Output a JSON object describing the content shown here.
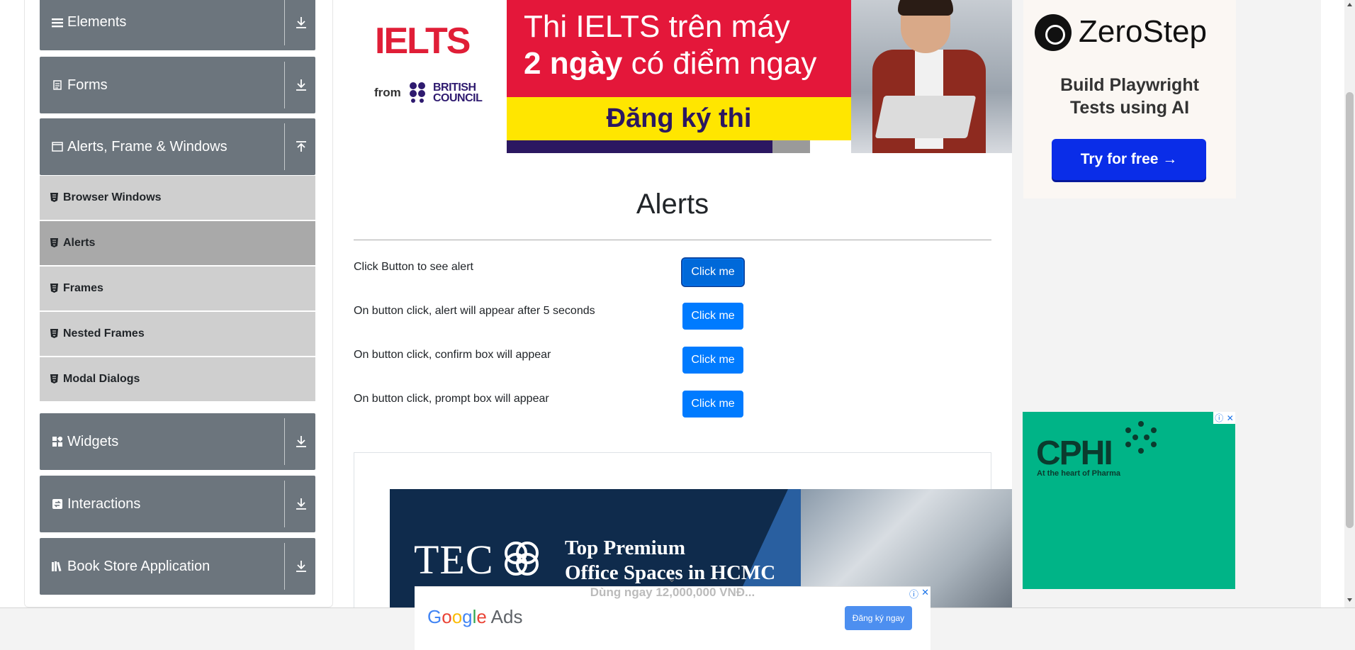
{
  "sidebar": {
    "groups": [
      {
        "label": "Elements",
        "icon": "hamburger-icon",
        "arrow": "download-icon"
      },
      {
        "label": "Forms",
        "icon": "document-icon",
        "arrow": "download-icon"
      },
      {
        "label": "Alerts, Frame & Windows",
        "icon": "window-icon",
        "arrow": "upload-icon"
      },
      {
        "label": "Widgets",
        "icon": "widgets-icon",
        "arrow": "download-icon"
      },
      {
        "label": "Interactions",
        "icon": "interactions-icon",
        "arrow": "download-icon"
      },
      {
        "label": "Book Store Application",
        "icon": "books-icon",
        "arrow": "download-icon"
      }
    ],
    "menu_items": [
      {
        "label": "Browser Windows",
        "active": false
      },
      {
        "label": "Alerts",
        "active": true
      },
      {
        "label": "Frames",
        "active": false
      },
      {
        "label": "Nested Frames",
        "active": false
      },
      {
        "label": "Modal Dialogs",
        "active": false
      }
    ]
  },
  "top_ad": {
    "logo": "IELTS",
    "from": "from",
    "council_line1": "BRITISH",
    "council_line2": "COUNCIL",
    "headline_line1": "Thi IELTS trên máy",
    "headline_bold": "2 ngày",
    "headline_line2_rest": " có điểm ngay",
    "cta": "Đăng ký thi"
  },
  "main": {
    "title": "Alerts",
    "rows": [
      {
        "label": "Click Button to see alert",
        "button": "Click me"
      },
      {
        "label": "On button click, alert will appear after 5 seconds",
        "button": "Click me"
      },
      {
        "label": "On button click, confirm box will appear",
        "button": "Click me"
      },
      {
        "label": "On button click, prompt box will appear",
        "button": "Click me"
      }
    ]
  },
  "teco_ad": {
    "logo": "TEC",
    "headline_line1": "Top Premium",
    "headline_line2": "Office Spaces in HCMC"
  },
  "zerostep_ad": {
    "name": "ZeroStep",
    "tagline_line1": "Build Playwright",
    "tagline_line2": "Tests using AI",
    "cta": "Try for free →"
  },
  "cphi_ad": {
    "logo": "CPHI",
    "subtitle": "At the heart of Pharma"
  },
  "anchor_ad": {
    "faded_text": "Dùng ngay 12,000,000 VNĐ...",
    "brand_ads": " Ads",
    "cta": "Đăng ký ngay",
    "info": "ⓘ",
    "close": "✕"
  },
  "colors": {
    "sidebar_header": "#6c757d",
    "menu_item": "#cfcfcf",
    "menu_active": "#a9a9a9",
    "primary_button": "#007bff"
  }
}
